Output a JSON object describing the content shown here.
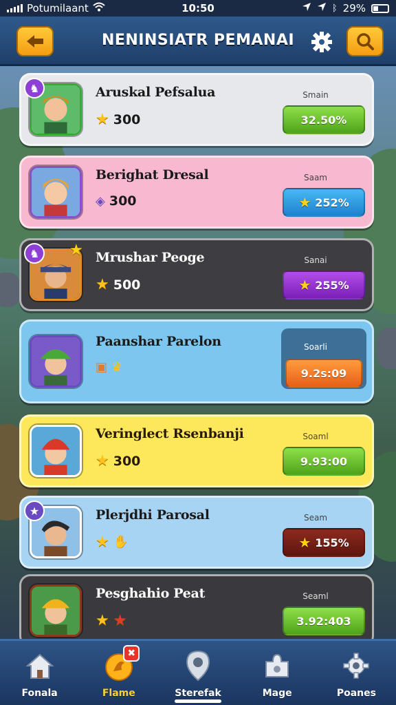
{
  "status": {
    "carrier": "Potumilaant",
    "time": "10:50",
    "battery": "29%"
  },
  "header": {
    "title": "NENINSIATR PEMANAI"
  },
  "players": [
    {
      "name": "Aruskal Pefsalua",
      "stat": "300",
      "label": "Smain",
      "pill": "32.50%",
      "pill_star": ""
    },
    {
      "name": "Berighat Dresal",
      "stat": "300",
      "label": "Saam",
      "pill": "252%",
      "pill_star": "★"
    },
    {
      "name": "Mrushar Peoge",
      "stat": "500",
      "label": "Sanai",
      "pill": "255%",
      "pill_star": "★"
    },
    {
      "name": "Paanshar Parelon",
      "stat": "",
      "label": "Soarli",
      "pill": "9.2s:09",
      "pill_star": ""
    },
    {
      "name": "Veringlect Rsenbanji",
      "stat": "300",
      "label": "Soaml",
      "pill": "9.93:00",
      "pill_star": ""
    },
    {
      "name": "Plerjdhi Parosal",
      "stat": "",
      "label": "Seam",
      "pill": "155%",
      "pill_star": "★"
    },
    {
      "name": "Pesghahio Peat",
      "stat": "",
      "label": "Seaml",
      "pill": "3.92:403",
      "pill_star": ""
    }
  ],
  "nav": [
    {
      "label": "Fonala",
      "icon": "home-icon"
    },
    {
      "label": "Flame",
      "icon": "flame-icon",
      "badge": "✖"
    },
    {
      "label": "Sterefak",
      "icon": "pin-icon"
    },
    {
      "label": "Mage",
      "icon": "puzzle-icon"
    },
    {
      "label": "Poanes",
      "icon": "gear-icon"
    }
  ],
  "colors": {
    "accent": "#f59d12",
    "header": "#1f3f6a"
  }
}
